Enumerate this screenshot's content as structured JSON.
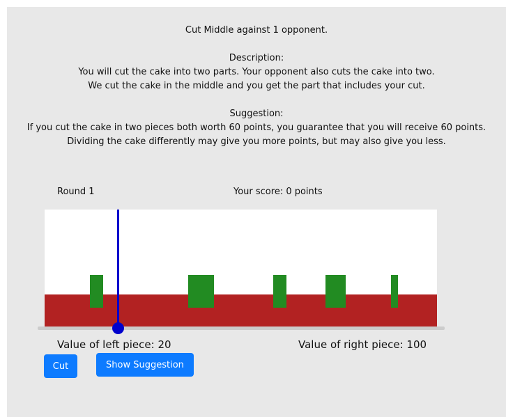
{
  "info": {
    "title": "Cut Middle against 1 opponent.",
    "description_heading": "Description:",
    "description_line1": "You will cut the cake into two parts. Your opponent also cuts the cake into two.",
    "description_line2": "We cut the cake in the middle and you get the part that includes your cut.",
    "suggestion_heading": "Suggestion:",
    "suggestion_line1": "If you cut the cake in two pieces both worth 60 points, you guarantee that you will receive 60 points.",
    "suggestion_line2": "Dividing the cake differently may give you more points, but may also give you less."
  },
  "status": {
    "round": "Round 1",
    "score": "Your score: 0 points"
  },
  "cake": {
    "base_color": "#b22222",
    "piece_color": "#228b22",
    "cut_color": "#0000cc",
    "cut_position_fraction": 0.19
  },
  "values": {
    "left": "Value of left piece: 20",
    "right": "Value of right piece: 100"
  },
  "buttons": {
    "cut": "Cut",
    "suggest": "Show Suggestion",
    "color": "#0d7bff"
  }
}
